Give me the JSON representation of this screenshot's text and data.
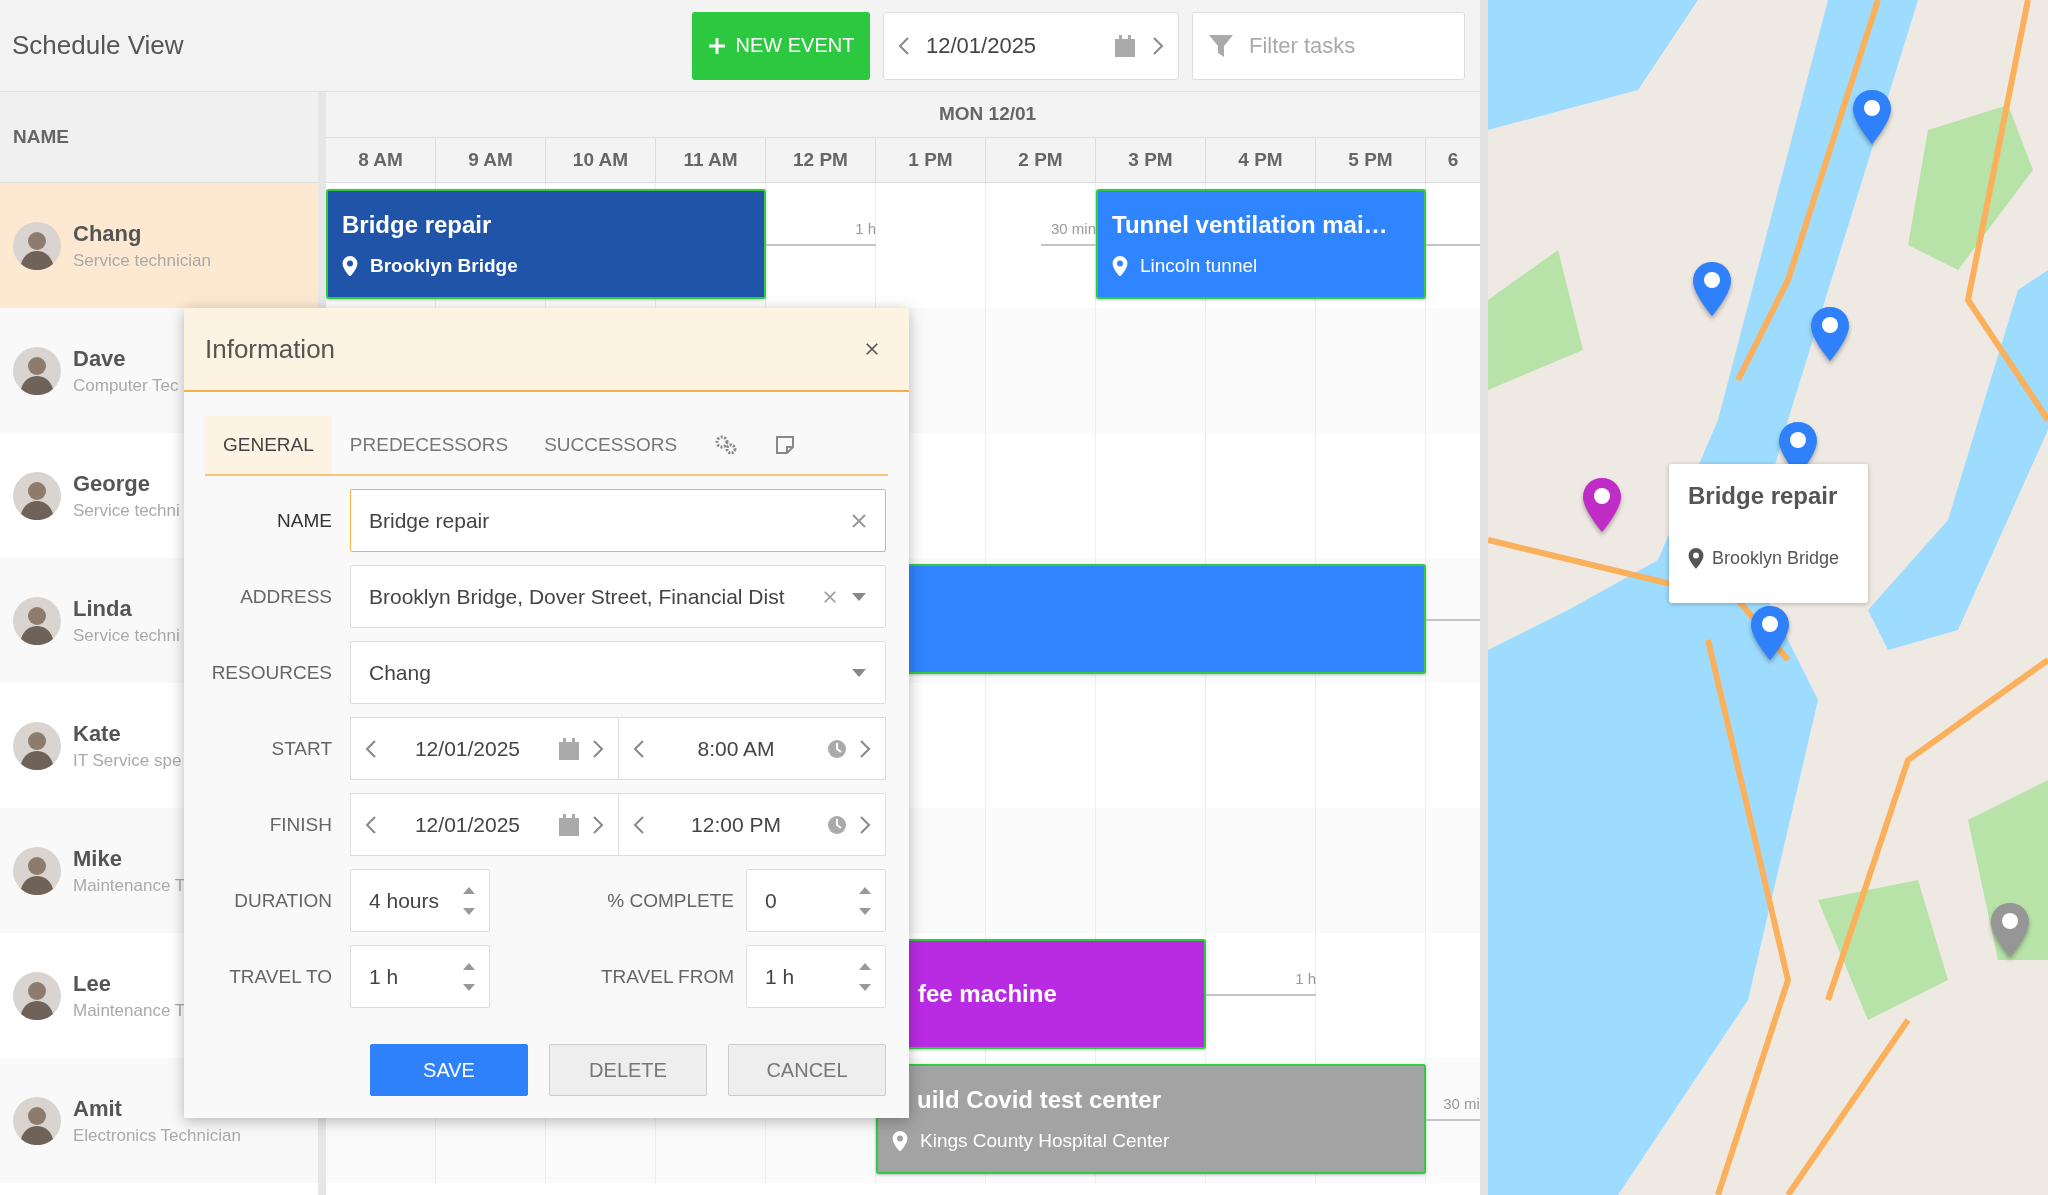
{
  "toolbar": {
    "title": "Schedule View",
    "new_event": "NEW EVENT",
    "date": "12/01/2025",
    "filter_placeholder": "Filter tasks"
  },
  "scheduler": {
    "name_header": "NAME",
    "day": "MON 12/01",
    "hours": [
      "8 AM",
      "9 AM",
      "10 AM",
      "11 AM",
      "12 PM",
      "1 PM",
      "2 PM",
      "3 PM",
      "4 PM",
      "5 PM",
      "6"
    ],
    "resources": [
      {
        "name": "Chang",
        "role": "Service technician",
        "selected": true,
        "events": [
          {
            "name": "Bridge repair",
            "location": "Brooklyn Bridge",
            "color": "#1f54a8",
            "travel": [
              {
                "kind": "after",
                "label": "1 h"
              }
            ]
          },
          {
            "name": "Tunnel ventilation mai…",
            "location": "Lincoln tunnel",
            "color": "#2f85ff",
            "travel": [
              {
                "kind": "before",
                "label": "30 min"
              },
              {
                "kind": "after"
              }
            ]
          }
        ]
      },
      {
        "name": "Dave",
        "role": "Computer Tec",
        "selected": false
      },
      {
        "name": "George",
        "role": "Service techni",
        "selected": false
      },
      {
        "name": "Linda",
        "role": "Service techni",
        "selected": false,
        "events": [
          {
            "color": "#3183fe",
            "travel": [
              {
                "kind": "after"
              }
            ]
          }
        ]
      },
      {
        "name": "Kate",
        "role": "IT Service spe",
        "selected": false
      },
      {
        "name": "Mike",
        "role": "Maintenance T",
        "selected": false
      },
      {
        "name": "Lee",
        "role": "Maintenance T",
        "selected": false,
        "events": [
          {
            "name": "fee machine",
            "color": "#b92be3",
            "travel": [
              {
                "kind": "after",
                "label": "1 h"
              }
            ]
          }
        ]
      },
      {
        "name": "Amit",
        "role": "Electronics Technician",
        "selected": false,
        "events": [
          {
            "name": "uild Covid test center",
            "location": "Kings County Hospital Center",
            "color": "#a3a3a3",
            "travel": [
              {
                "kind": "after",
                "label": "30 mi"
              }
            ]
          }
        ]
      }
    ]
  },
  "dialog": {
    "title": "Information",
    "tabs": [
      {
        "kind": "text",
        "label": "GENERAL",
        "selected": true
      },
      {
        "kind": "text",
        "label": "PREDECESSORS",
        "selected": false
      },
      {
        "kind": "text",
        "label": "SUCCESSORS",
        "selected": false
      },
      {
        "kind": "icon",
        "selected": false
      },
      {
        "kind": "icon",
        "selected": false
      }
    ],
    "fields": [
      {
        "kind": "text",
        "label": "NAME",
        "value": "Bridge repair",
        "focused": true
      },
      {
        "kind": "combo",
        "label": "ADDRESS",
        "value": "Brooklyn Bridge, Dover Street, Financial Dist",
        "clearable": true,
        "focused": false
      },
      {
        "kind": "combo",
        "label": "RESOURCES",
        "value": "Chang",
        "clearable": false,
        "focused": false
      },
      {
        "kind": "datetime",
        "label": "START",
        "date": "12/01/2025",
        "time": "8:00 AM",
        "focused": false
      },
      {
        "kind": "datetime",
        "label": "FINISH",
        "date": "12/01/2025",
        "time": "12:00 PM",
        "focused": false
      },
      {
        "kind": "numbers",
        "items": [
          {
            "label": "DURATION",
            "value": "4 hours",
            "focused": false
          },
          {
            "label": "% COMPLETE",
            "value": "0",
            "focused": false
          }
        ]
      },
      {
        "kind": "numbers",
        "items": [
          {
            "label": "TRAVEL TO",
            "value": "1 h",
            "focused": false
          },
          {
            "label": "TRAVEL FROM",
            "value": "1 h",
            "focused": false
          }
        ]
      }
    ],
    "buttons": [
      {
        "kind": "primary",
        "label": "SAVE"
      },
      {
        "kind": "secondary",
        "label": "DELETE"
      },
      {
        "kind": "secondary",
        "label": "CANCEL"
      }
    ]
  },
  "map": {
    "markers": [
      {
        "color": "#2f80fb"
      },
      {
        "color": "#2f80fb"
      },
      {
        "color": "#2f80fb"
      },
      {
        "color": "#2f80fb"
      },
      {
        "color": "#2f80fb"
      },
      {
        "color": "#c02cc6"
      },
      {
        "color": "#969696"
      }
    ],
    "popup": {
      "title": "Bridge repair",
      "location": "Brooklyn Bridge"
    }
  }
}
